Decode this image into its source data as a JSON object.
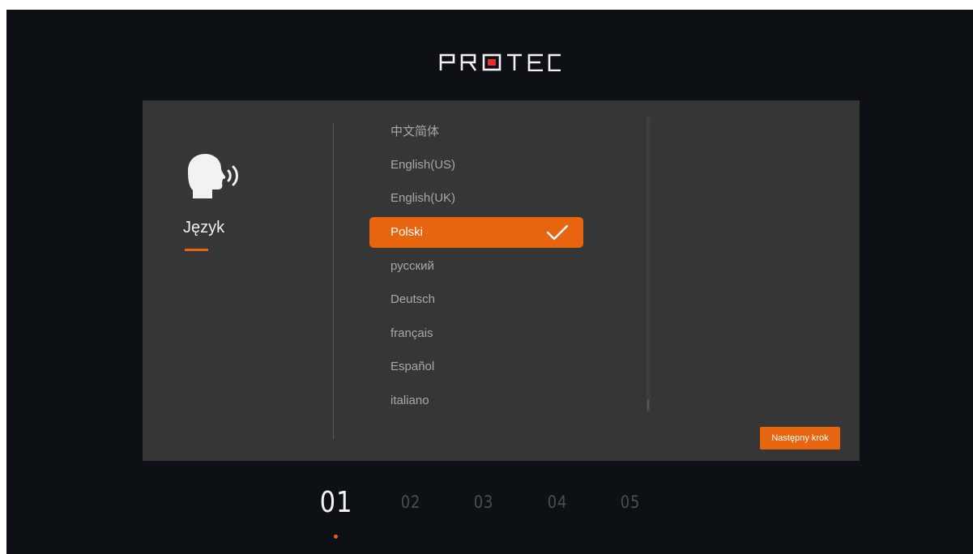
{
  "brand": {
    "name": "PROTEC",
    "accent": "#e8650f"
  },
  "section": {
    "label": "Język",
    "icon": "speaking-head-icon"
  },
  "languages": [
    {
      "label": "中文简体",
      "selected": false
    },
    {
      "label": "English(US)",
      "selected": false
    },
    {
      "label": "English(UK)",
      "selected": false
    },
    {
      "label": "Polski",
      "selected": true
    },
    {
      "label": "русский",
      "selected": false
    },
    {
      "label": "Deutsch",
      "selected": false
    },
    {
      "label": "français",
      "selected": false
    },
    {
      "label": "Español",
      "selected": false
    },
    {
      "label": "italiano",
      "selected": false
    }
  ],
  "next_button": {
    "label": "Następny krok"
  },
  "steps": [
    {
      "label": "01",
      "active": true
    },
    {
      "label": "02",
      "active": false
    },
    {
      "label": "03",
      "active": false
    },
    {
      "label": "04",
      "active": false
    },
    {
      "label": "05",
      "active": false
    }
  ]
}
